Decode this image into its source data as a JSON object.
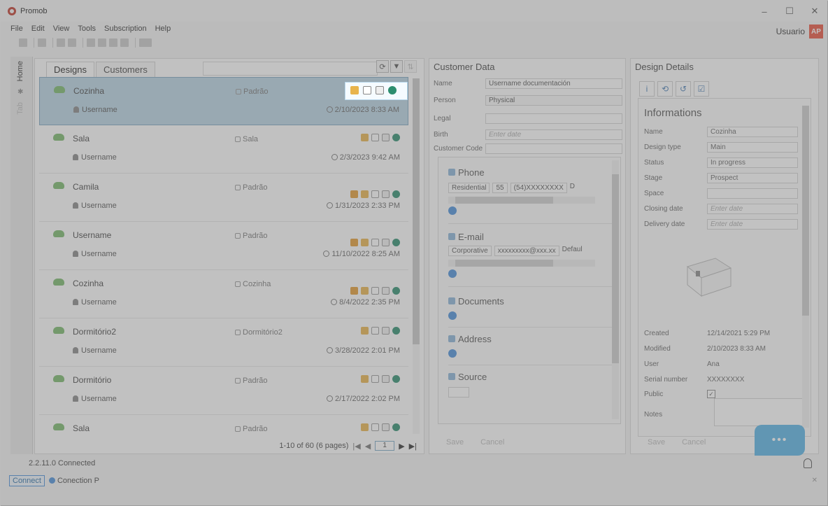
{
  "window": {
    "title": "Promob",
    "controls": [
      "–",
      "☐",
      "✕"
    ]
  },
  "menu": [
    "File",
    "Edit",
    "View",
    "Tools",
    "Subscription",
    "Help"
  ],
  "user": {
    "name": "Usuario",
    "initials": "AP"
  },
  "vtabs": {
    "home": "Home",
    "other": "Tab"
  },
  "designs": {
    "tabs": [
      "Designs",
      "Customers"
    ],
    "rows": [
      {
        "name": "Cozinha",
        "user": "Username",
        "environment": "Padrão",
        "date": "2/10/2023 8:33 AM"
      },
      {
        "name": "Sala",
        "user": "Username",
        "environment": "Sala",
        "date": "2/3/2023 9:42 AM"
      },
      {
        "name": "Camila",
        "user": "Username",
        "environment": "Padrão",
        "date": "1/31/2023 2:33 PM"
      },
      {
        "name": "Username",
        "user": "Username",
        "environment": "Padrão",
        "date": "11/10/2022 8:25 AM"
      },
      {
        "name": "Cozinha",
        "user": "Username",
        "environment": "Cozinha",
        "date": "8/4/2022 2:35 PM"
      },
      {
        "name": "Dormitório2",
        "user": "Username",
        "environment": "Dormitório2",
        "date": "3/28/2022 2:01 PM"
      },
      {
        "name": "Dormitório",
        "user": "Username",
        "environment": "Padrão",
        "date": "2/17/2022 2:02 PM"
      },
      {
        "name": "Sala",
        "user": "",
        "environment": "Padrão",
        "date": ""
      }
    ],
    "pager": {
      "summary": "1-10 of 60 (6 pages)",
      "page": "1"
    }
  },
  "customer": {
    "title": "Customer Data",
    "fields": {
      "name_label": "Name",
      "name_value": "Username documentación",
      "person_label": "Person",
      "person_value": "Physical",
      "legal_label": "Legal",
      "birth_label": "Birth",
      "birth_placeholder": "Enter date",
      "code_label": "Customer Code"
    },
    "phone": {
      "title": "Phone",
      "type": "Residential",
      "ddi": "55",
      "number": "(54)XXXXXXXX",
      "extra": "D"
    },
    "email": {
      "title": "E-mail",
      "type": "Corporative",
      "value": "xxxxxxxxx@xxx.xx",
      "extra": "Defaul"
    },
    "documents": {
      "title": "Documents"
    },
    "address": {
      "title": "Address"
    },
    "source": {
      "title": "Source"
    },
    "buttons": {
      "save": "Save",
      "cancel": "Cancel"
    }
  },
  "details": {
    "title": "Design Details",
    "section": "Informations",
    "name_label": "Name",
    "name_value": "Cozinha",
    "type_label": "Design type",
    "type_value": "Main",
    "status_label": "Status",
    "status_value": "In progress",
    "stage_label": "Stage",
    "stage_value": "Prospect",
    "space_label": "Space",
    "closing_label": "Closing date",
    "closing_placeholder": "Enter date",
    "delivery_label": "Delivery date",
    "delivery_placeholder": "Enter date",
    "created_label": "Created",
    "created_value": "12/14/2021 5:29 PM",
    "modified_label": "Modified",
    "modified_value": "2/10/2023 8:33 AM",
    "user_label": "User",
    "user_value": "Ana",
    "serial_label": "Serial number",
    "serial_value": "XXXXXXXX",
    "public_label": "Public",
    "public_checked": "✓",
    "notes_label": "Notes",
    "buttons": {
      "save": "Save",
      "cancel": "Cancel"
    }
  },
  "status": {
    "version": "2.2.11.0 Connected"
  },
  "connection": {
    "connect_label": "Connect",
    "conn_name": "Conection P"
  },
  "chat": {
    "dots": "•••"
  },
  "colors": {
    "accent": "#4a90d9",
    "brand": "#c0392b",
    "selection": "#b9d4e4"
  }
}
